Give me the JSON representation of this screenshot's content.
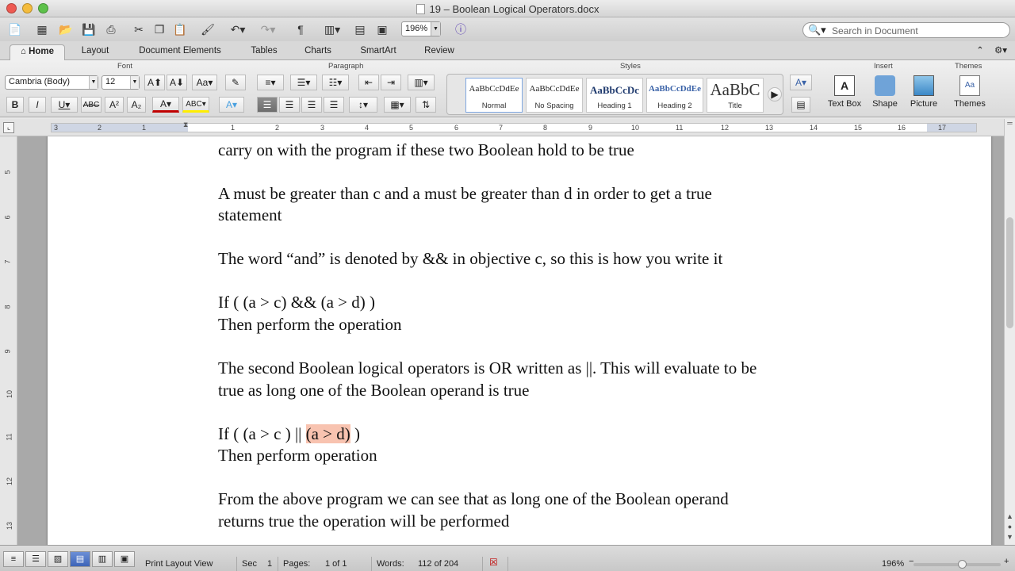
{
  "window": {
    "title": "19 – Boolean Logical Operators.docx"
  },
  "toolbar": {
    "zoom": "196%"
  },
  "search": {
    "placeholder": "Search in Document"
  },
  "ribbon_tabs": [
    {
      "label": "Home"
    },
    {
      "label": "Layout"
    },
    {
      "label": "Document Elements"
    },
    {
      "label": "Tables"
    },
    {
      "label": "Charts"
    },
    {
      "label": "SmartArt"
    },
    {
      "label": "Review"
    }
  ],
  "groups": {
    "font": "Font",
    "paragraph": "Paragraph",
    "styles": "Styles",
    "insert": "Insert",
    "themes": "Themes"
  },
  "font": {
    "name": "Cambria (Body)",
    "size": "12"
  },
  "styles": [
    {
      "preview": "AaBbCcDdEe",
      "name": "Normal"
    },
    {
      "preview": "AaBbCcDdEe",
      "name": "No Spacing"
    },
    {
      "preview": "AaBbCcDc",
      "name": "Heading 1"
    },
    {
      "preview": "AaBbCcDdEe",
      "name": "Heading 2"
    },
    {
      "preview": "AaBbC",
      "name": "Title"
    }
  ],
  "insert": {
    "text_box": "Text Box",
    "shape": "Shape",
    "picture": "Picture"
  },
  "themes_btn": "Themes",
  "ruler": {
    "h": [
      "3",
      "2",
      "1",
      "1",
      "2",
      "3",
      "4",
      "5",
      "6",
      "7",
      "8",
      "9",
      "10",
      "11",
      "12",
      "13",
      "14",
      "15",
      "16",
      "17"
    ],
    "v": [
      "5",
      "6",
      "7",
      "8",
      "9",
      "10",
      "11",
      "12",
      "13"
    ]
  },
  "document": {
    "lines": [
      "carry on with the program if these two Boolean hold to be true",
      "A must be greater than c and a must be greater than d in order to get a true",
      "statement",
      "The word “and” is denoted by && in objective c, so this is how you write it",
      "If ( (a > c) && (a > d) )",
      "Then perform the operation",
      "The second Boolean logical operators is OR written as ||. This will evaluate to be",
      "true as long one of the Boolean operand is true",
      "If ( (a > c ) || ",
      "(a > d)",
      " )",
      "Then perform operation",
      "From the above program we can see that as long one of the Boolean operand",
      "returns true the operation will be performed"
    ]
  },
  "status": {
    "view": "Print Layout View",
    "sec_label": "Sec",
    "sec": "1",
    "pages_label": "Pages:",
    "pages": "1 of 1",
    "words_label": "Words:",
    "words": "112 of 204",
    "zoom": "196%"
  }
}
